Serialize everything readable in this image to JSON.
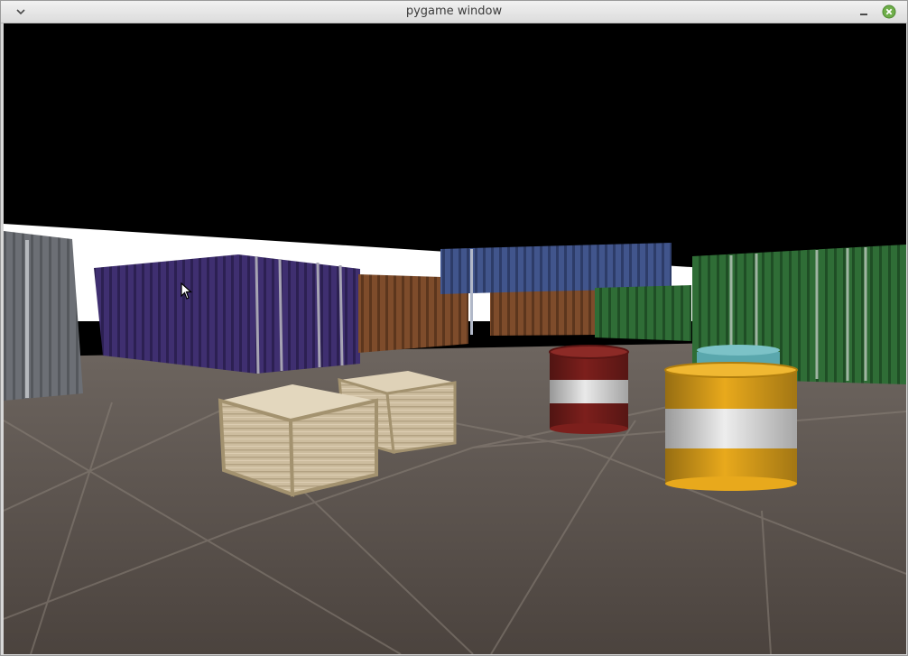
{
  "window": {
    "title": "pygame window"
  },
  "icons": {
    "menu": "chevron-down-icon",
    "minimize": "minimize-icon",
    "close": "close-icon",
    "cursor": "mouse-pointer-icon"
  },
  "colors": {
    "sky": "#000000",
    "horizon": "#ffffff",
    "floor": "#5b524c",
    "titlebar": "#e6e6e6",
    "close_button": "#6fae4a",
    "container_gray": "#6b6e74",
    "container_purple": "#3d2d6b",
    "container_rust": "#7a4a2a",
    "container_blue": "#3c4f84",
    "container_green": "#2f6a35",
    "crate": "#c9b89a",
    "barrel_red": "#7c1f1c",
    "barrel_yellow": "#e8a91c",
    "barrel_teal": "#5aa7ad"
  },
  "scene": {
    "type": "3d-yard",
    "objects": [
      "gray-container",
      "purple-container",
      "rust-container",
      "blue-container",
      "green-container-small",
      "green-container-large",
      "rust-container-back",
      "wooden-crate-front",
      "wooden-crate-back",
      "red-barrel",
      "yellow-barrel",
      "teal-barrel"
    ]
  }
}
